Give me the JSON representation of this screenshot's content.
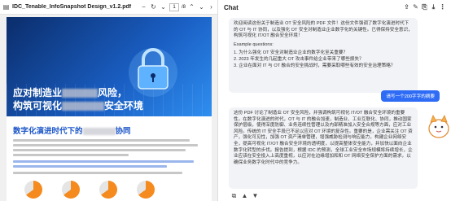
{
  "pdf_viewer": {
    "filename": "IDC_Tenable_InfoSnapshot Design_v1.2.pdf",
    "page_current": "1",
    "page_total": "/8",
    "hero_title_line1_a": "应对制造业",
    "hero_title_line1_b": "风险，",
    "hero_title_line2_a": "构筑可视化",
    "hero_title_line2_b": "安全环境",
    "section_title_a": "数字化演进时代下的",
    "section_title_b": "协同"
  },
  "chat": {
    "title": "Chat",
    "intro": "欢迎阅读这份关于制造业 OT 安全风险的 PDF 文件！这份文件强调了数字化演进时代下的 OT 与 IT 协同，以及强化 OT 安全对制造业企业数字化的关键性。已得保持安全意识，构筑可视化 IT/OT 融合安全环境！",
    "examples_label": "Example questions:",
    "examples": [
      "1. 为什么强化 OT 安全对制造业企业的数字化至关重要？",
      "2. 2023 年发生的几起重大 OT 攻击事件给企业带来了哪些损失？",
      "3. 企业在面对 IT 与 OT 融合的安全挑战时，需要采取哪些有效的安全治理策略？"
    ],
    "user_message": "请写一个200字字的摘要",
    "response_text": "这份 PDF 讨论了制造业 OT 安全风险，并强调构筑可视化 IT/OT 融合安全环境的重要性。在数字化演进的时代，OT 与 IT 的融合加速，制造业、工业互联化、协同，推动国家保护层级，使得深度防御、业务连续性管理以及内部精准加入安全合规等方面，应对工业风险。传统的 IT 安全手段已不足以应对 OT 环境的复杂性。重要的是，企业需关注 OT 资产，强化可见性，加强 OT 资产清单管理，增强威胁检测与响应能力，构建企业网络安全，提高可视化 IT/OT 融合安全环境的透明度，以提高整体安全能力，并加快以面向企业数字化转型的步伐。报告提到，根据 IDC 的预测，全球工业安全市场规模将持续增长，企业应该在安全投入上高度重视，以应对在边缘增加和和 OT 网络安全保护方面的需求，以确保业务数字化时代中的竞争力。"
  },
  "colors": {
    "accent": "#2f6cf5",
    "hero_dark": "#0b2d6b",
    "section_title": "#1c56c8",
    "chart_orange": "#f58a1f"
  }
}
